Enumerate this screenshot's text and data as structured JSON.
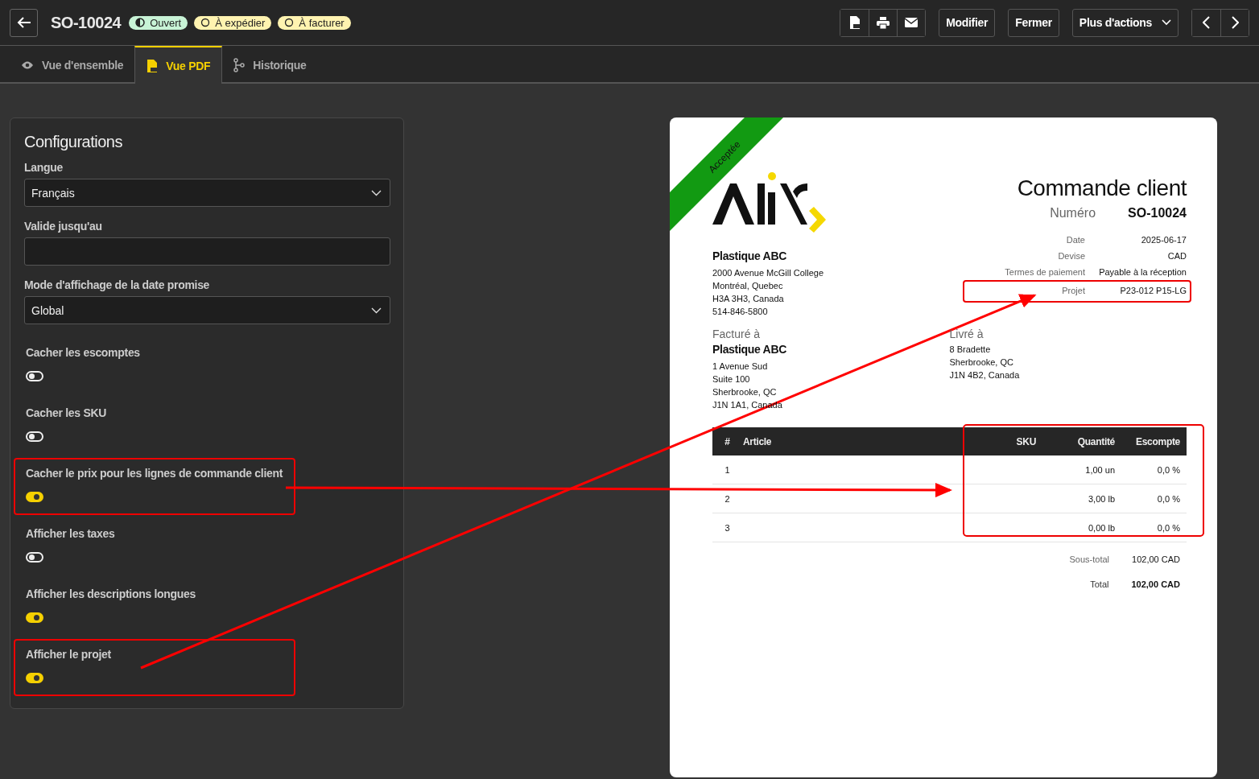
{
  "header": {
    "order_number": "SO-10024",
    "badges": [
      {
        "label": "Ouvert",
        "kind": "open"
      },
      {
        "label": "À expédier",
        "kind": "pending"
      },
      {
        "label": "À facturer",
        "kind": "pending"
      }
    ],
    "actions": [
      "Modifier",
      "Fermer"
    ],
    "more_actions": "Plus d'actions"
  },
  "tabs": [
    {
      "label": "Vue d'ensemble",
      "selected": false
    },
    {
      "label": "Vue PDF",
      "selected": true
    },
    {
      "label": "Historique",
      "selected": false
    }
  ],
  "config": {
    "title": "Configurations",
    "fields": [
      {
        "kind": "select",
        "label": "Langue",
        "value": "Français"
      },
      {
        "kind": "input",
        "label": "Valide jusqu'au"
      },
      {
        "kind": "select",
        "label": "Mode d'affichage de la date promise",
        "value": "Global"
      },
      {
        "kind": "toggle",
        "label": "Cacher les escomptes",
        "on": false,
        "highlighted": false
      },
      {
        "kind": "toggle",
        "label": "Cacher les SKU",
        "on": false,
        "highlighted": false
      },
      {
        "kind": "toggle",
        "label": "Cacher le prix pour les lignes de commande client",
        "on": true,
        "highlighted": true
      },
      {
        "kind": "toggle",
        "label": "Afficher les taxes",
        "on": false,
        "highlighted": false
      },
      {
        "kind": "toggle",
        "label": "Afficher les descriptions longues",
        "on": true,
        "highlighted": false
      },
      {
        "kind": "toggle",
        "label": "Afficher le projet",
        "on": true,
        "highlighted": true
      }
    ]
  },
  "document": {
    "ribbon": "Acceptée",
    "title": "Commande client",
    "number_label": "Numéro",
    "number": "SO-10024",
    "company": {
      "name": "Plastique ABC",
      "lines": [
        "2000 Avenue McGill College",
        "Montréal, Quebec",
        "H3A 3H3, Canada",
        "514-846-5800"
      ]
    },
    "meta": [
      {
        "label": "Date",
        "value": "2025-06-17",
        "highlighted": false
      },
      {
        "label": "Devise",
        "value": "CAD",
        "highlighted": false
      },
      {
        "label": "Termes de paiement",
        "value": "Payable à la réception",
        "highlighted": false
      },
      {
        "label": "Projet",
        "value": "P23-012 P15-LG",
        "highlighted": true
      }
    ],
    "billing": {
      "heading": "Facturé à",
      "name": "Plastique ABC",
      "lines": [
        "1 Avenue Sud",
        "Suite 100",
        "Sherbrooke, QC",
        "J1N 1A1, Canada"
      ]
    },
    "shipping": {
      "heading": "Livré à",
      "lines": [
        "8 Bradette",
        "Sherbrooke, QC",
        "J1N 4B2, Canada"
      ]
    },
    "table": {
      "columns": [
        "#",
        "Article",
        "SKU",
        "Quantité",
        "Escompte"
      ],
      "rows": [
        [
          "1",
          "",
          "",
          "1,00 un",
          "0,0 %"
        ],
        [
          "2",
          "",
          "",
          "3,00 lb",
          "0,0 %"
        ],
        [
          "3",
          "",
          "",
          "0,00 lb",
          "0,0 %"
        ]
      ]
    },
    "totals": [
      {
        "label": "Sous-total",
        "value": "102,00 CAD",
        "kind": "subtotal"
      },
      {
        "label": "Total",
        "value": "102,00 CAD",
        "kind": "total"
      }
    ]
  }
}
